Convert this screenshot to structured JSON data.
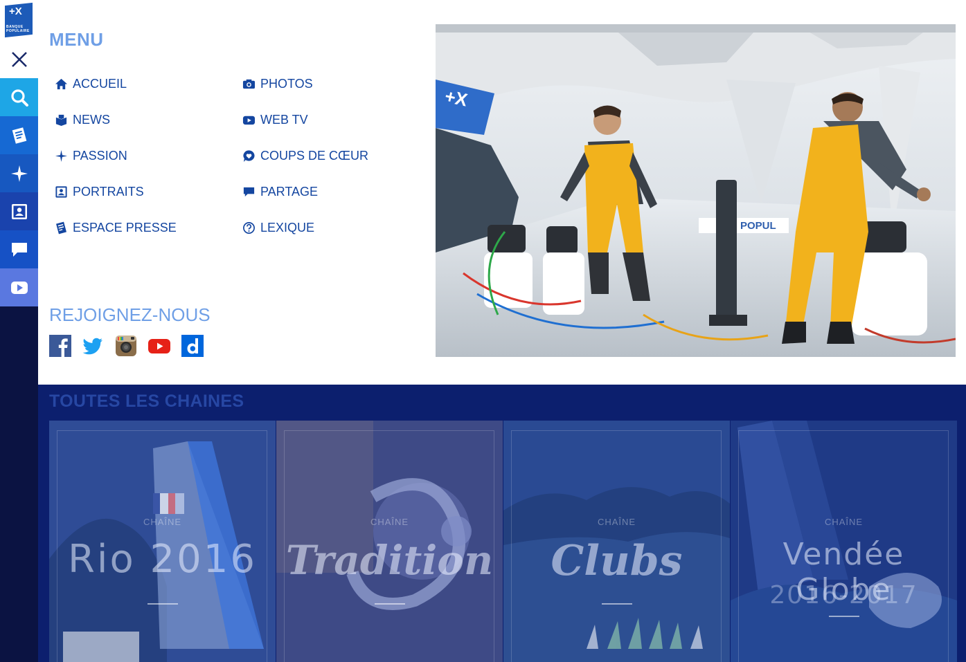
{
  "brand": {
    "logo_mark": "+X",
    "logo_text": "BANQUE POPULAIRE"
  },
  "rail": [
    {
      "name": "close",
      "icon": "close-icon",
      "bg": "#ffffff"
    },
    {
      "name": "search",
      "icon": "search-icon",
      "bg": "#1ea6e6"
    },
    {
      "name": "press",
      "icon": "newspaper-icon",
      "bg": "#1669d3"
    },
    {
      "name": "passion",
      "icon": "star-icon",
      "bg": "#1758c0"
    },
    {
      "name": "portraits",
      "icon": "portrait-icon",
      "bg": "#1a43ad"
    },
    {
      "name": "partage",
      "icon": "chat-icon",
      "bg": "#1651c5"
    },
    {
      "name": "webtv",
      "icon": "play-icon",
      "bg": "#5a78e0"
    }
  ],
  "menu": {
    "title": "MENU",
    "items_left": [
      {
        "label": "ACCUEIL",
        "icon": "home-icon"
      },
      {
        "label": "NEWS",
        "icon": "news-icon"
      },
      {
        "label": "PASSION",
        "icon": "star-icon"
      },
      {
        "label": "PORTRAITS",
        "icon": "portrait-icon"
      },
      {
        "label": "ESPACE PRESSE",
        "icon": "newspaper-icon"
      }
    ],
    "items_right": [
      {
        "label": "PHOTOS",
        "icon": "camera-icon"
      },
      {
        "label": "WEB TV",
        "icon": "play-icon"
      },
      {
        "label": "COUPS DE CŒUR",
        "icon": "heart-bubble-icon"
      },
      {
        "label": "PARTAGE",
        "icon": "chat-icon"
      },
      {
        "label": "LEXIQUE",
        "icon": "question-icon"
      }
    ]
  },
  "join": {
    "title": "REJOIGNEZ-NOUS",
    "socials": [
      {
        "name": "facebook",
        "icon": "facebook-icon",
        "color": "#3b5998"
      },
      {
        "name": "twitter",
        "icon": "twitter-icon",
        "color": "#1da1f2"
      },
      {
        "name": "instagram",
        "icon": "instagram-icon",
        "color": "#8a6d4a"
      },
      {
        "name": "youtube",
        "icon": "youtube-icon",
        "color": "#e62117"
      },
      {
        "name": "dailymotion",
        "icon": "dailymotion-icon",
        "color": "#0066dc"
      }
    ]
  },
  "photo": {
    "boat_banner_text": "POPUL"
  },
  "channels": {
    "title": "TOUTES LES CHAINES",
    "cards": [
      {
        "kicker": "CHAÎNE",
        "title": "Rio 2016",
        "subtitle": ""
      },
      {
        "kicker": "CHAÎNE",
        "title": "Tradition",
        "subtitle": ""
      },
      {
        "kicker": "CHAÎNE",
        "title": "Clubs",
        "subtitle": ""
      },
      {
        "kicker": "CHAÎNE",
        "title": "Vendée Globe",
        "subtitle": "2016-2017"
      }
    ]
  },
  "colors": {
    "menu_text": "#1446a0",
    "menu_title": "#6f9fe6",
    "channels_bg": "#0c1f6e"
  }
}
